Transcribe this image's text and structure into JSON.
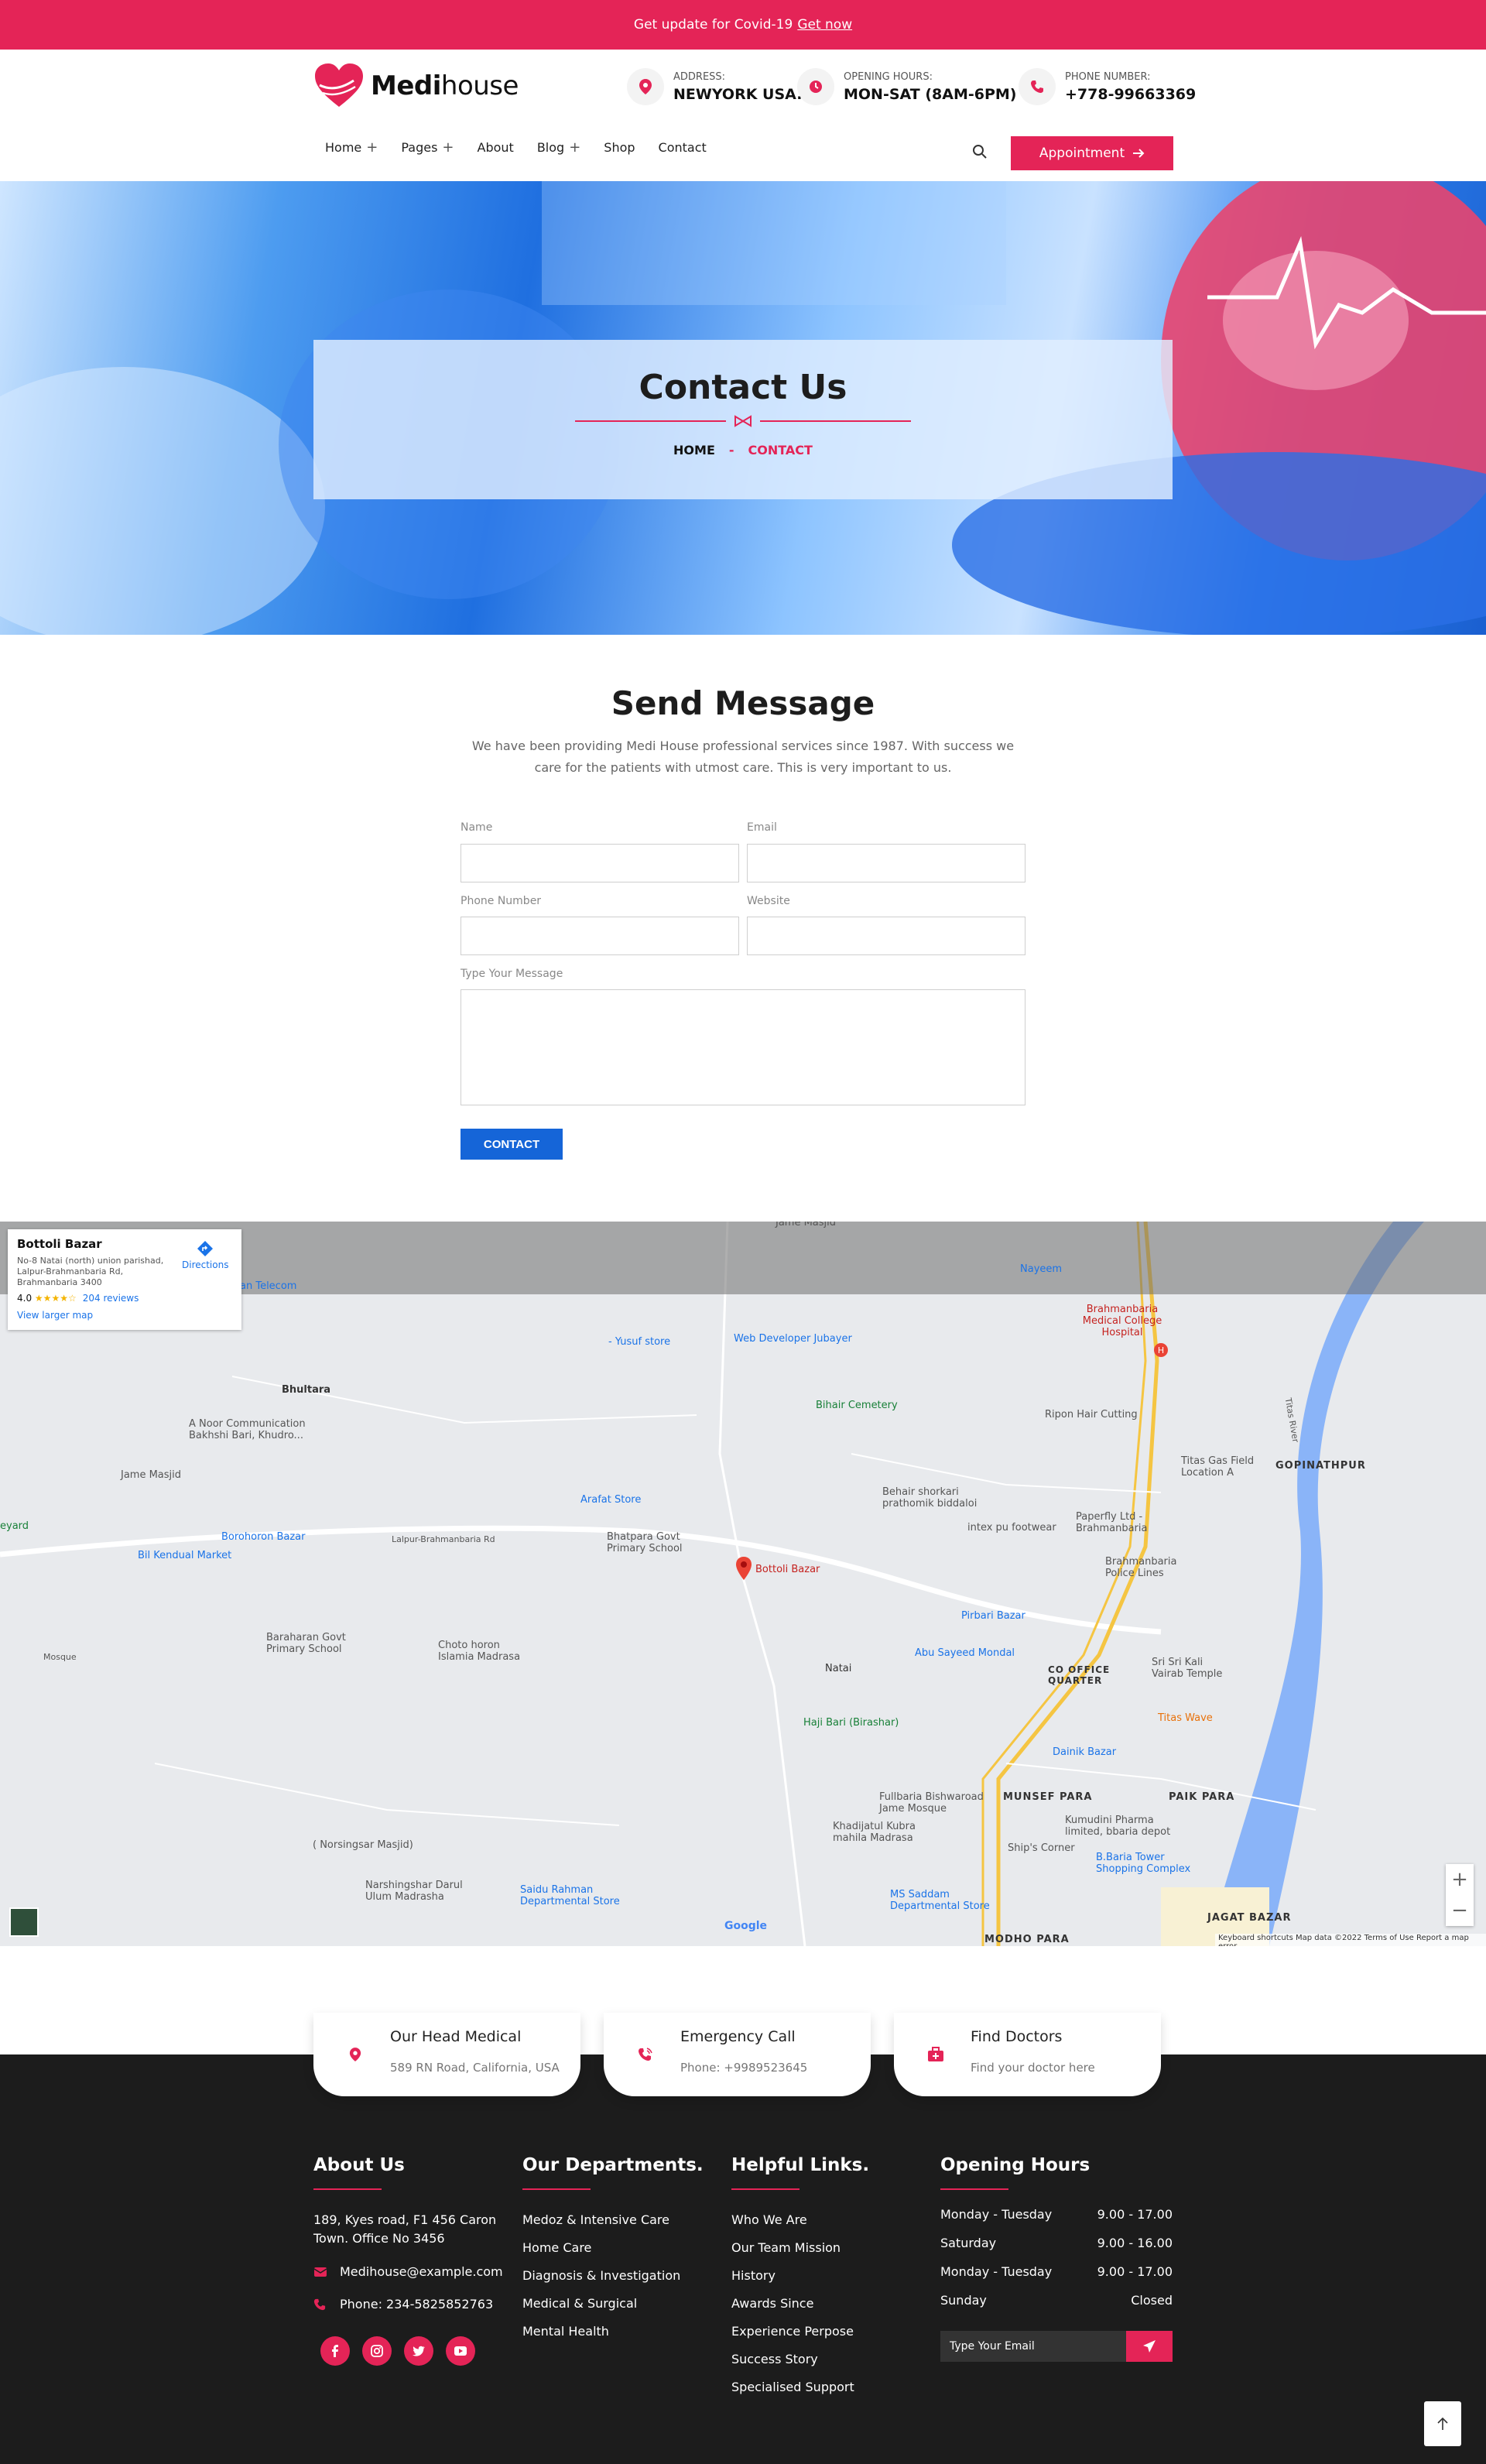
{
  "topbar": {
    "text": "Get update for Covid-19",
    "link": "Get now"
  },
  "logo": {
    "bold": "Medi",
    "light": "house"
  },
  "header": {
    "address": {
      "label": "ADDRESS:",
      "value": "NEWYORK USA."
    },
    "hours": {
      "label": "OPENING HOURS:",
      "value": "MON-SAT (8AM-6PM)"
    },
    "phone": {
      "label": "PHONE NUMBER:",
      "value": "+778-99663369"
    }
  },
  "nav": {
    "items": [
      {
        "label": "Home"
      },
      {
        "label": "Pages"
      },
      {
        "label": "About"
      },
      {
        "label": "Blog"
      },
      {
        "label": "Shop"
      },
      {
        "label": "Contact"
      }
    ],
    "appointment": "Appointment"
  },
  "hero": {
    "title": "Contact Us",
    "breadcrumb_home": "HOME",
    "breadcrumb_sep": "-",
    "breadcrumb_current": "CONTACT"
  },
  "send_message": {
    "title": "Send Message",
    "description": "We have been providing Medi House professional services since 1987. With success we care for the patients with utmost care. This is very important to us.",
    "labels": {
      "name": "Name",
      "email": "Email",
      "phone": "Phone Number",
      "website": "Website",
      "message": "Type Your Message"
    },
    "button": "CONTACT"
  },
  "map": {
    "card": {
      "title": "Bottoli Bazar",
      "address": "No-8 Natai (north) union parishad, Lalpur-Brahmanbaria Rd, Brahmanbaria 3400",
      "rating": "4.0",
      "stars": "★★★★☆",
      "reviews": "204 reviews",
      "larger_map": "View larger map",
      "directions": "Directions"
    },
    "labels": {
      "bhultara": "Bhultara",
      "yusuf": "- Yusuf store",
      "webdev": "Web Developer Jubayer",
      "medical": "Brahmanbaria Medical College Hospital",
      "bihair": "Bihair Cemetery",
      "ripon": "Ripon Hair Cutting",
      "titas_gas": "Titas Gas Field Location A",
      "gopinath": "GOPINATHPUR",
      "anoor": "A Noor Communication Bakhshi Bari, Khudro...",
      "jame": "Jame Masjid",
      "arafat": "Arafat Store",
      "behair": "Behair shorkari prathomik biddaloi",
      "intex": "intex pu footwear",
      "paperfly": "Paperfly Ltd - Brahmanbaria",
      "borohoron": "Borohoron Bazar",
      "bil": "Bil Kendual Market",
      "lalpur_rd": "Lalpur-Brahmanbaria Rd",
      "bhatpara": "Bhatpara Govt Primary School",
      "bottoli": "Bottoli Bazar",
      "police": "Brahmanbaria Police Lines",
      "baraharan": "Baraharan Govt Primary School",
      "choto": "Choto horon Islamia Madrasa",
      "pirbari": "Pirbari Bazar",
      "abu": "Abu Sayeed Mondal",
      "natai": "Natai",
      "co_office": "CO OFFICE QUARTER",
      "sri": "Sri Sri Kali Vairab Temple",
      "hajibari": "Haji Bari (Birashar)",
      "titas_wave": "Titas Wave",
      "dainik": "Dainik Bazar",
      "fullbaria": "Fullbaria Bishwaroad Jame Mosque",
      "munsef": "MUNSEF PARA",
      "paikpara": "PAIK PARA",
      "khadijatul": "Khadijatul Kubra mahila Madrasa",
      "kumudini": "Kumudini Pharma limited, bbaria depot",
      "shipscorner": "Ship's Corner",
      "btower": "B.Baria Tower Shopping Complex",
      "norsingsar": "( Norsingsar Masjid)",
      "narshingshar": "Narshingshar Darul Ulum Madrasha",
      "saidu": "Saidu Rahman Departmental Store",
      "ms_saddam": "MS Saddam Departmental Store",
      "jagat": "JAGAT BAZAR",
      "modho": "MODHO PARA",
      "telecom": "an Telecom",
      "nayeem": "Nayeem",
      "jame_top": "Jame Masjid",
      "titas_river": "Titas River",
      "mosque_left": "Mosque",
      "eyard": "eyard"
    },
    "google": "Google",
    "footer": "Keyboard shortcuts    Map data ©2022    Terms of Use    Report a map error"
  },
  "contact_cards": [
    {
      "title": "Our Head Medical",
      "sub": "589 RN Road, California, USA"
    },
    {
      "title": "Emergency Call",
      "sub": "Phone: +9989523645"
    },
    {
      "title": "Find Doctors",
      "sub": "Find your doctor here"
    }
  ],
  "footer": {
    "about": {
      "title": "About Us",
      "address": "189, Kyes road, F1 456 Caron Town. Office No 3456",
      "email": "Medihouse@example.com",
      "phone": "Phone: 234-5825852763"
    },
    "departments": {
      "title": "Our Departments.",
      "items": [
        "Medoz & Intensive Care",
        "Home Care",
        "Diagnosis & Investigation",
        "Medical & Surgical",
        "Mental Health"
      ]
    },
    "links": {
      "title": "Helpful Links.",
      "items": [
        "Who We Are",
        "Our Team Mission",
        "History",
        "Awards Since",
        "Experience Perpose",
        "Success Story",
        "Specialised Support"
      ]
    },
    "hours": {
      "title": "Opening Hours",
      "rows": [
        {
          "day": "Monday - Tuesday",
          "time": "9.00 - 17.00"
        },
        {
          "day": "Saturday",
          "time": "9.00 - 16.00"
        },
        {
          "day": "Monday - Tuesday",
          "time": "9.00 - 17.00"
        },
        {
          "day": "Sunday",
          "time": "Closed"
        }
      ],
      "email_placeholder": "Type Your Email"
    }
  },
  "colors": {
    "accent": "#e42457",
    "button_blue": "#1565d8",
    "footer_bg": "#1c1c1c"
  }
}
